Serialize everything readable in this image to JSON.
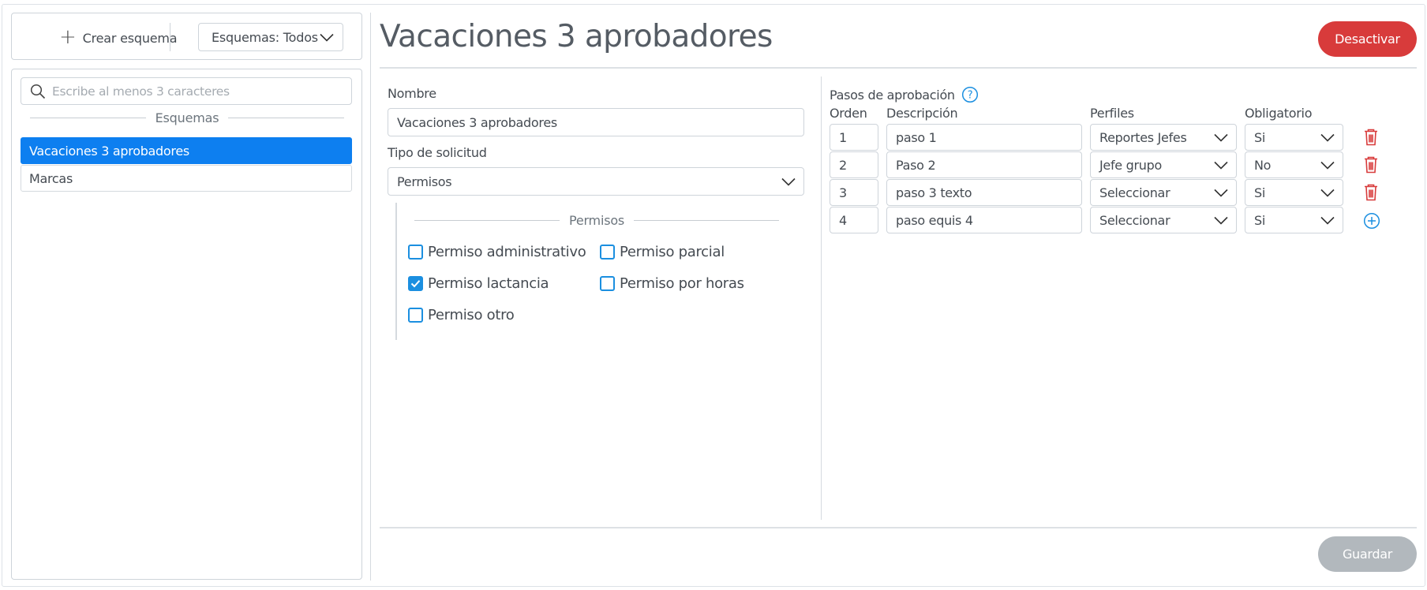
{
  "sidebar": {
    "create_label": "Crear esquema",
    "filter_label": "Esquemas: Todos",
    "search_placeholder": "Escribe al menos 3 caracteres",
    "section_title": "Esquemas",
    "items": [
      {
        "label": "Vacaciones 3 aprobadores",
        "active": true
      },
      {
        "label": "Marcas",
        "active": false
      }
    ]
  },
  "header": {
    "title": "Vacaciones 3 aprobadores",
    "deactivate_label": "Desactivar"
  },
  "form": {
    "name_label": "Nombre",
    "name_value": "Vacaciones 3 aprobadores",
    "type_label": "Tipo de solicitud",
    "type_value": "Permisos",
    "permissions_title": "Permisos",
    "permissions": [
      {
        "label": "Permiso administrativo",
        "checked": false
      },
      {
        "label": "Permiso parcial",
        "checked": false
      },
      {
        "label": "Permiso lactancia",
        "checked": true
      },
      {
        "label": "Permiso por horas",
        "checked": false
      },
      {
        "label": "Permiso otro",
        "checked": false
      }
    ]
  },
  "steps": {
    "title": "Pasos de aprobación",
    "columns": [
      "Orden",
      "Descripción",
      "Perfiles",
      "Obligatorio"
    ],
    "rows": [
      {
        "order": "1",
        "description": "paso 1",
        "profile": "Reportes Jefes",
        "required": "Si"
      },
      {
        "order": "2",
        "description": "Paso 2",
        "profile": "Jefe grupo",
        "required": "No"
      },
      {
        "order": "3",
        "description": "paso 3 texto",
        "profile": "Seleccionar",
        "required": "Si"
      },
      {
        "order": "4",
        "description": "paso equis 4",
        "profile": "Seleccionar",
        "required": "Si"
      }
    ]
  },
  "footer": {
    "save_label": "Guardar"
  },
  "colors": {
    "primary": "#0d7ff0",
    "danger": "#d83b3b",
    "disabled": "#b2b8bd",
    "checkbox": "#1b8fe0"
  }
}
